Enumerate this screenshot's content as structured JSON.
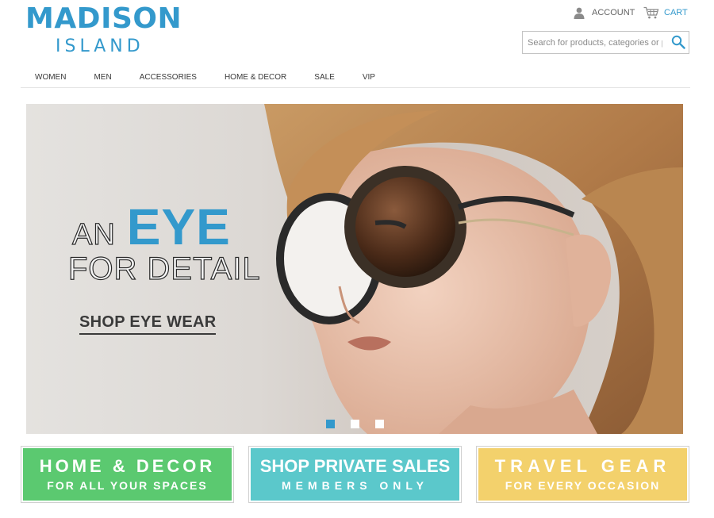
{
  "header": {
    "logo_main": "MADISON",
    "logo_sub": "ISLAND",
    "account_label": "ACCOUNT",
    "cart_label": "CART",
    "account_icon": "person-icon",
    "cart_icon": "cart-icon"
  },
  "search": {
    "placeholder": "Search for products, categories or pa",
    "value": "",
    "icon": "search-icon"
  },
  "nav": {
    "items": [
      {
        "label": "WOMEN"
      },
      {
        "label": "MEN"
      },
      {
        "label": "ACCESSORIES"
      },
      {
        "label": "HOME & DECOR"
      },
      {
        "label": "SALE"
      },
      {
        "label": "VIP"
      }
    ]
  },
  "hero": {
    "line1_small": "AN",
    "line1_large": "EYE",
    "line2": "FOR DETAIL",
    "cta": "SHOP EYE WEAR",
    "slide_count": 3,
    "active_slide": 1
  },
  "promos": [
    {
      "title": "HOME & DECOR",
      "subtitle": "FOR ALL YOUR SPACES",
      "color": "#5bc970"
    },
    {
      "title": "SHOP PRIVATE SALES",
      "subtitle": "MEMBERS ONLY",
      "color": "#5bc8cb"
    },
    {
      "title": "TRAVEL GEAR",
      "subtitle": "FOR EVERY OCCASION",
      "color": "#f3d16c"
    }
  ],
  "colors": {
    "brand": "#3399cc",
    "text": "#3a3a3a",
    "muted": "#636363"
  }
}
